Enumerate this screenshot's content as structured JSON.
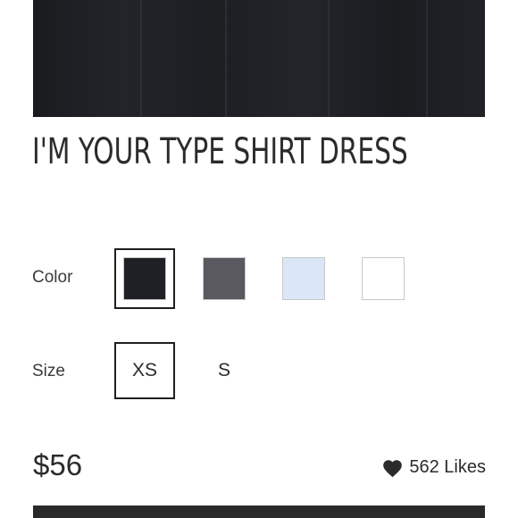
{
  "product": {
    "title": "I'M YOUR TYPE SHIRT DRESS",
    "image_description": "black-dress-image"
  },
  "color": {
    "label": "Color",
    "options": [
      {
        "name": "black",
        "hex": "#1f2025",
        "selected": true
      },
      {
        "name": "charcoal",
        "hex": "#5a5960",
        "selected": false
      },
      {
        "name": "light-blue",
        "hex": "#dbe7f6",
        "selected": false
      },
      {
        "name": "white",
        "hex": "#ffffff",
        "selected": false
      }
    ]
  },
  "size": {
    "label": "Size",
    "options": [
      {
        "label": "XS",
        "selected": true
      },
      {
        "label": "S",
        "selected": false
      }
    ]
  },
  "price": "$56",
  "likes": {
    "text": "562 Likes",
    "icon": "heart-icon"
  },
  "colors": {
    "text": "#2b2b2b",
    "selected_border": "#1f1f1f",
    "buy_bar": "#2a2a2a"
  }
}
